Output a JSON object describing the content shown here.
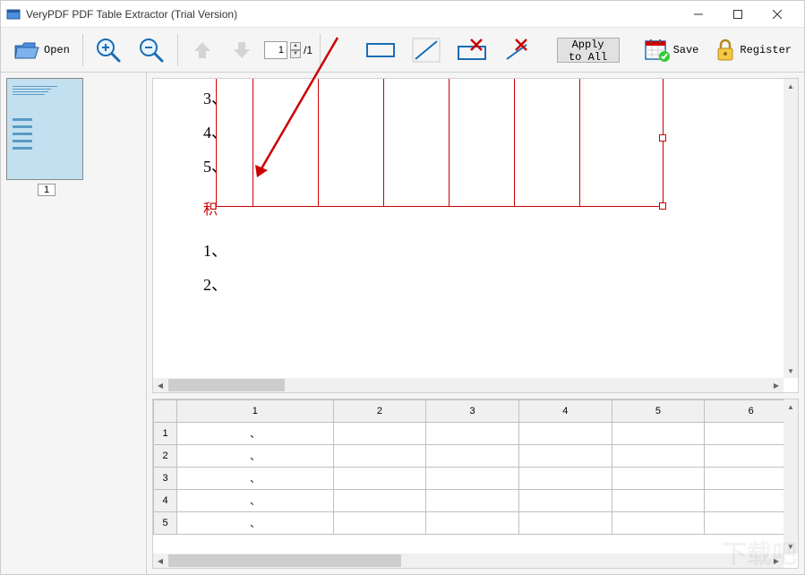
{
  "window": {
    "title": "VeryPDF PDF Table Extractor (Trial Version)"
  },
  "toolbar": {
    "open_label": "Open",
    "page_current": "1",
    "page_total": "/1",
    "apply_all_label": "Apply to All",
    "save_label": "Save",
    "register_label": "Register"
  },
  "sidebar": {
    "thumb_page_label": "1"
  },
  "preview": {
    "row_labels": [
      "3、",
      "4、",
      "5、",
      "积",
      "1、",
      "2、"
    ]
  },
  "grid": {
    "col_headers": [
      "1",
      "2",
      "3",
      "4",
      "5",
      "6"
    ],
    "row_headers": [
      "1",
      "2",
      "3",
      "4",
      "5"
    ],
    "rows": [
      {
        "c1": "、"
      },
      {
        "c1": "、"
      },
      {
        "c1": "、"
      },
      {
        "c1": "、"
      },
      {
        "c1": "、"
      }
    ]
  }
}
